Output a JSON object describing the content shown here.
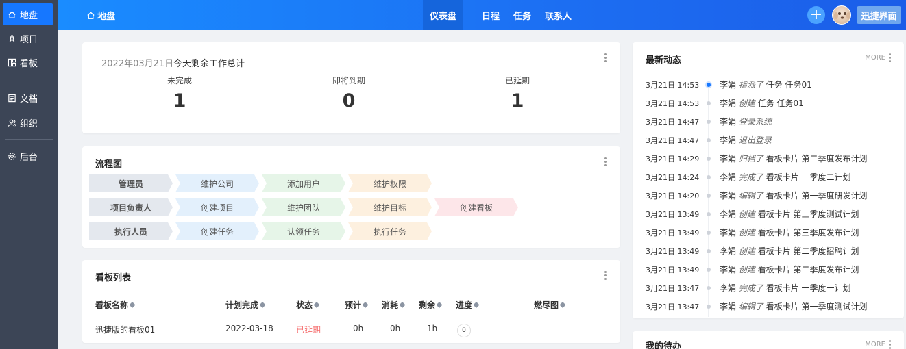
{
  "sidebar": {
    "items": [
      {
        "label": "地盘",
        "icon": "home-icon"
      },
      {
        "label": "项目",
        "icon": "rocket-icon"
      },
      {
        "label": "看板",
        "icon": "board-icon"
      },
      {
        "label": "文档",
        "icon": "document-icon"
      },
      {
        "label": "组织",
        "icon": "people-icon"
      },
      {
        "label": "后台",
        "icon": "gear-icon"
      }
    ]
  },
  "topbar": {
    "home_label": "地盘",
    "nav": [
      {
        "label": "仪表盘",
        "active": true
      },
      {
        "label": "日程"
      },
      {
        "label": "任务"
      },
      {
        "label": "联系人"
      }
    ],
    "plus": "+",
    "quick_label": "迅捷界面"
  },
  "summary": {
    "date": "2022年03月21日",
    "subtitle": "今天剩余工作总计",
    "stats": [
      {
        "label": "未完成",
        "value": "1"
      },
      {
        "label": "即将到期",
        "value": "0"
      },
      {
        "label": "已延期",
        "value": "1"
      }
    ]
  },
  "flow": {
    "title": "流程图",
    "rows": [
      [
        "管理员",
        "维护公司",
        "添加用户",
        "维护权限"
      ],
      [
        "项目负责人",
        "创建项目",
        "维护团队",
        "维护目标",
        "创建看板"
      ],
      [
        "执行人员",
        "创建任务",
        "认领任务",
        "执行任务"
      ]
    ]
  },
  "boards": {
    "title": "看板列表",
    "headers": [
      "看板名称",
      "计划完成",
      "状态",
      "预计",
      "消耗",
      "剩余",
      "进度",
      "燃尽图"
    ],
    "rows": [
      {
        "name": "迅捷版的看板01",
        "plan": "2022-03-18",
        "status": "已延期",
        "estimate": "0h",
        "consumed": "0h",
        "left": "1h",
        "progress": "0"
      }
    ],
    "status_color": "#f56c6c"
  },
  "activity": {
    "title": "最新动态",
    "more": "MORE",
    "items": [
      {
        "time": "3月21日 14:53",
        "user": "李娟",
        "action": "指派了",
        "target": "任务 任务01"
      },
      {
        "time": "3月21日 14:53",
        "user": "李娟",
        "action": "创建",
        "target": "任务 任务01"
      },
      {
        "time": "3月21日 14:47",
        "user": "李娟",
        "action": "登录系统",
        "target": ""
      },
      {
        "time": "3月21日 14:47",
        "user": "李娟",
        "action": "退出登录",
        "target": ""
      },
      {
        "time": "3月21日 14:29",
        "user": "李娟",
        "action": "归档了",
        "target": "看板卡片 第二季度发布计划"
      },
      {
        "time": "3月21日 14:24",
        "user": "李娟",
        "action": "完成了",
        "target": "看板卡片 一季度二计划"
      },
      {
        "time": "3月21日 14:20",
        "user": "李娟",
        "action": "编辑了",
        "target": "看板卡片 第一季度研发计划"
      },
      {
        "time": "3月21日 13:49",
        "user": "李娟",
        "action": "创建",
        "target": "看板卡片 第三季度测试计划"
      },
      {
        "time": "3月21日 13:49",
        "user": "李娟",
        "action": "创建",
        "target": "看板卡片 第三季度发布计划"
      },
      {
        "time": "3月21日 13:49",
        "user": "李娟",
        "action": "创建",
        "target": "看板卡片 第二季度招聘计划"
      },
      {
        "time": "3月21日 13:49",
        "user": "李娟",
        "action": "创建",
        "target": "看板卡片 第二季度发布计划"
      },
      {
        "time": "3月21日 13:47",
        "user": "李娟",
        "action": "完成了",
        "target": "看板卡片 一季度一计划"
      },
      {
        "time": "3月21日 13:47",
        "user": "李娟",
        "action": "编辑了",
        "target": "看板卡片 第一季度测试计划"
      }
    ]
  },
  "todo": {
    "title": "我的待办",
    "more": "MORE"
  },
  "colors": {
    "accent": "#1677ff",
    "sidebar_bg": "#3c4556",
    "delayed": "#f56c6c"
  }
}
